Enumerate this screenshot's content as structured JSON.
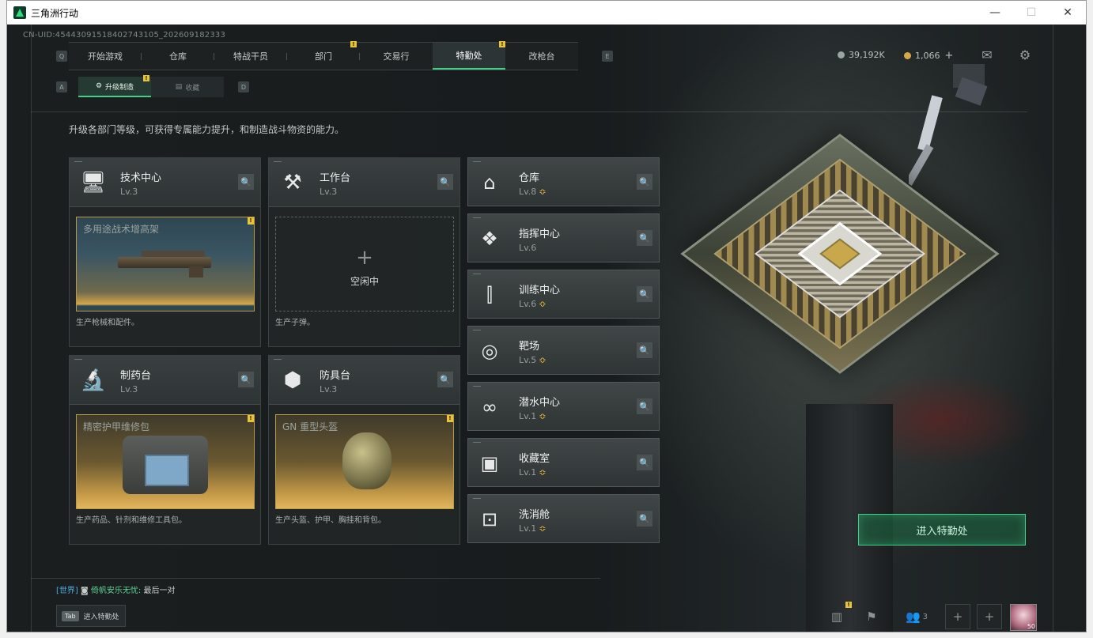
{
  "window": {
    "title": "三角洲行动",
    "minimize": "—",
    "maximize": "☐",
    "close": "✕"
  },
  "header": {
    "uid": "CN-UID:4544309151840274310​5_202609182333",
    "left_key": "Q",
    "right_key": "E",
    "tabs": [
      {
        "label": "开始游戏"
      },
      {
        "label": "仓库"
      },
      {
        "label": "特战干员"
      },
      {
        "label": "部门",
        "badge": "!"
      },
      {
        "label": "交易行"
      },
      {
        "label": "特勤处",
        "badge": "!",
        "active": true
      },
      {
        "label": "改枪台"
      }
    ],
    "currency1": "39,192K",
    "currency2": "1,066",
    "currency_add": "+"
  },
  "subnav": {
    "left_key": "A",
    "right_key": "D",
    "tabs": [
      {
        "label": "升级制造",
        "badge": "!",
        "active": true
      },
      {
        "label": "收藏"
      }
    ]
  },
  "description": "升级各部门等级，可获得专属能力提升，和制造战斗物资的能力。",
  "departments": [
    {
      "name": "技术中心",
      "level": "Lv.3",
      "slot_label": "多用途战术增高架",
      "footer": "生产枪械和配件。",
      "badge": "!"
    },
    {
      "name": "工作台",
      "level": "Lv.3",
      "slot_label": "",
      "idle_plus": "+",
      "idle_text": "空闲中",
      "footer": "生产子弹。"
    },
    {
      "name": "制药台",
      "level": "Lv.3",
      "slot_label": "精密护甲维修包",
      "footer": "生产药品、针剂和维修工具包。",
      "badge": "!"
    },
    {
      "name": "防具台",
      "level": "Lv.3",
      "slot_label": "GN 重型头盔",
      "footer": "生产头盔、护甲、胸挂和背包。",
      "badge": "!"
    }
  ],
  "side_departments": [
    {
      "name": "仓库",
      "level": "Lv.8",
      "upgradable": true
    },
    {
      "name": "指挥中心",
      "level": "Lv.6",
      "upgradable": false
    },
    {
      "name": "训练中心",
      "level": "Lv.6",
      "upgradable": true
    },
    {
      "name": "靶场",
      "level": "Lv.5",
      "upgradable": true
    },
    {
      "name": "潜水中心",
      "level": "Lv.1",
      "upgradable": true
    },
    {
      "name": "收藏室",
      "level": "Lv.1",
      "upgradable": true
    },
    {
      "name": "洗消舱",
      "level": "Lv.1",
      "upgradable": true
    }
  ],
  "upgrade_mark": "≎",
  "enter_button": "进入特勤处",
  "chat": {
    "channel": "[世界]",
    "user": "倚帆安乐无忧:",
    "message": "最后一对"
  },
  "tab_hint": {
    "key": "Tab",
    "label": "进入特勤处"
  },
  "bottom_bar": {
    "friends_count": "3",
    "stats_badge": "!",
    "avatar_level": "50"
  },
  "colors": {
    "accent": "#3fd08a",
    "notify": "#e8c23a",
    "upgrade": "#e3b53a"
  },
  "icons": {
    "search": "search-icon",
    "mail": "mail-icon",
    "settings": "gear-icon"
  }
}
